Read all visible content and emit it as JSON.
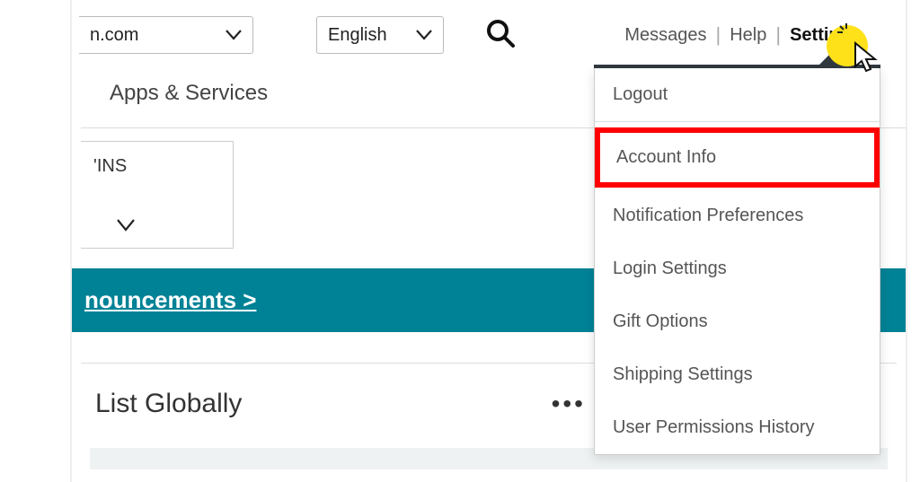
{
  "topbar": {
    "marketplace": "n.com",
    "language": "English"
  },
  "toplinks": {
    "messages": "Messages",
    "help": "Help",
    "settings": "Settings"
  },
  "subnav": {
    "apps": "Apps & Services"
  },
  "partial": {
    "text": "'INS"
  },
  "banner": {
    "text": "nouncements >"
  },
  "card": {
    "title": "List Globally"
  },
  "menu": {
    "items": [
      "Logout",
      "Account Info",
      "Notification Preferences",
      "Login Settings",
      "Gift Options",
      "Shipping Settings",
      "User Permissions History"
    ]
  }
}
